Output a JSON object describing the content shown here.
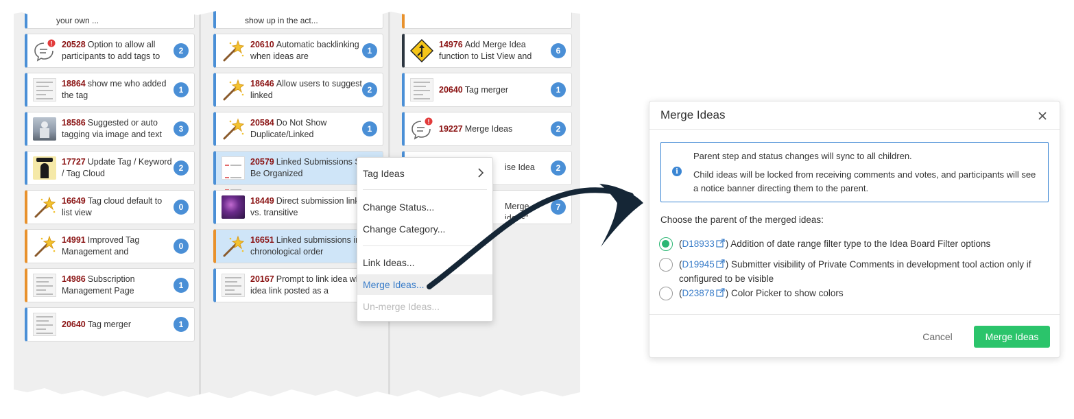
{
  "board": {
    "columns": [
      {
        "top_partial": "your own ...",
        "cards": [
          {
            "id": "20528",
            "title": "Option to allow all participants to add tags to",
            "count": "2",
            "thumb": "comment-alert-icon",
            "accent": "blue"
          },
          {
            "id": "18864",
            "title": "show me who added the tag",
            "count": "1",
            "thumb": "document-thumb",
            "accent": "blue"
          },
          {
            "id": "18586",
            "title": "Suggested or auto tagging via image and text",
            "count": "3",
            "thumb": "robot-photo",
            "accent": "blue"
          },
          {
            "id": "17727",
            "title": "Update Tag / Keyword / Tag Cloud",
            "count": "2",
            "thumb": "person-photo",
            "accent": "blue"
          },
          {
            "id": "16649",
            "title": "Tag cloud default to list view",
            "count": "0",
            "thumb": "magic-wand-icon",
            "accent": "orange"
          },
          {
            "id": "14991",
            "title": "Improved Tag Management and",
            "count": "0",
            "thumb": "magic-wand-icon",
            "accent": "orange"
          },
          {
            "id": "14986",
            "title": "Subscription Management Page",
            "count": "1",
            "thumb": "document-thumb",
            "accent": "orange"
          },
          {
            "id": "20640",
            "title": "Tag merger",
            "count": "1",
            "thumb": "document-thumb",
            "accent": "blue"
          }
        ]
      },
      {
        "top_partial": "show up in the act...",
        "cards": [
          {
            "id": "20610",
            "title": "Automatic backlinking when ideas are",
            "count": "1",
            "thumb": "magic-wand-icon",
            "accent": "blue"
          },
          {
            "id": "18646",
            "title": "Allow users to suggest linked",
            "count": "2",
            "thumb": "magic-wand-icon",
            "accent": "blue"
          },
          {
            "id": "20584",
            "title": "Do Not Show Duplicate/Linked",
            "count": "1",
            "thumb": "magic-wand-icon",
            "accent": "blue"
          },
          {
            "id": "20579",
            "title": "Linked Submissions Should Be Organized",
            "count": "",
            "thumb": "checklist-thumb",
            "accent": "blue",
            "selected": true
          },
          {
            "id": "18449",
            "title": "Direct submission linking vs. transitive",
            "count": "",
            "thumb": "abstract-photo",
            "accent": "blue"
          },
          {
            "id": "16651",
            "title": "Linked submissions in chronological order",
            "count": "",
            "thumb": "magic-wand-icon",
            "accent": "orange",
            "selected": true
          },
          {
            "id": "20167",
            "title": "Prompt to link idea when idea link posted as a",
            "count": "",
            "thumb": "document-thumb",
            "accent": "blue"
          }
        ]
      },
      {
        "cards": [
          {
            "id": "14976",
            "title": "Add Merge Idea function to List View and",
            "count": "6",
            "thumb": "merge-sign-icon",
            "accent": "dark"
          },
          {
            "id": "20640",
            "title": "Tag merger",
            "count": "1",
            "thumb": "document-thumb",
            "accent": "blue"
          },
          {
            "id": "19227",
            "title": "Merge Ideas",
            "count": "2",
            "thumb": "comment-alert-icon",
            "accent": "blue"
          },
          {
            "id": "",
            "title": "ise Idea",
            "count": "2",
            "thumb": "",
            "accent": "blue",
            "partial": true
          },
          {
            "id": "",
            "title": "Merge ideas\"",
            "count": "7",
            "thumb": "",
            "accent": "blue",
            "partial": true
          }
        ]
      }
    ]
  },
  "context_menu": {
    "items": [
      {
        "label": "Tag Ideas",
        "submenu": true
      },
      {
        "label": "Change Status..."
      },
      {
        "label": "Change Category..."
      },
      {
        "label": "Link Ideas..."
      },
      {
        "label": "Merge Ideas...",
        "active": true
      },
      {
        "label": "Un-merge Ideas...",
        "disabled": true
      }
    ]
  },
  "dialog": {
    "title": "Merge Ideas",
    "info_line1": "Parent step and status changes will sync to all children.",
    "info_line2": "Child ideas will be locked from receiving comments and votes, and participants will see a notice banner directing them to the parent.",
    "choose_label": "Choose the parent of the merged ideas:",
    "options": [
      {
        "link": "D18933",
        "text": ") Addition of date range filter type to the Idea Board Filter options",
        "selected": true
      },
      {
        "link": "D19945",
        "text": ") Submitter visibility of Private Comments in development tool action only if configured to be visible",
        "selected": false
      },
      {
        "link": "D23878",
        "text": ") Color Picker to show colors",
        "selected": false
      }
    ],
    "cancel_label": "Cancel",
    "merge_label": "Merge Ideas"
  },
  "colors": {
    "accent_blue": "#4a8fd6",
    "accent_orange": "#e8912c",
    "id_red": "#8b1414",
    "selected_row": "#cfe5f8",
    "primary_green": "#2bc46b",
    "link_blue": "#3a7dc9",
    "arrow": "#152636"
  }
}
